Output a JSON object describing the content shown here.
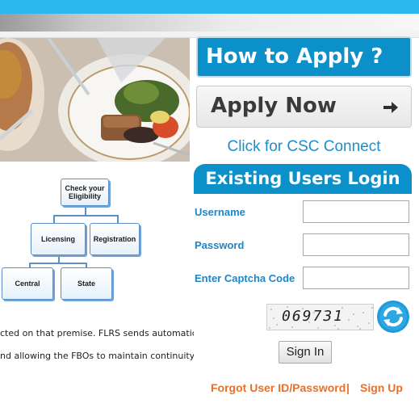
{
  "how_to_apply": {
    "label": "How to Apply ?"
  },
  "apply_now": {
    "label": "Apply Now",
    "icon": "arrow-right-icon"
  },
  "csc_link": {
    "label": "Click for CSC Connect"
  },
  "flowchart": {
    "eligibility": [
      "Check your",
      "Eligibility"
    ],
    "licensing": "Licensing",
    "registration": "Registration",
    "central": "Central",
    "state": "State"
  },
  "body_text": {
    "line1": "cted on that premise. FLRS sends automatic",
    "line2": "nd allowing the FBOs to maintain continuity"
  },
  "login": {
    "header": "Existing Users Login",
    "username_label": "Username",
    "username_value": "",
    "password_label": "Password",
    "password_value": "",
    "captcha_label": "Enter Captcha Code",
    "captcha_value": "",
    "captcha_image_text": "069731",
    "refresh_icon": "refresh-icon",
    "signin_label": "Sign In",
    "forgot_label": "Forgot User ID/Password",
    "separator": "|",
    "signup_label": "Sign Up"
  },
  "colors": {
    "accent_blue": "#0b90c9",
    "top_bar": "#2bb8ec",
    "label_blue": "#1f86c4",
    "link_orange": "#e8702a"
  }
}
